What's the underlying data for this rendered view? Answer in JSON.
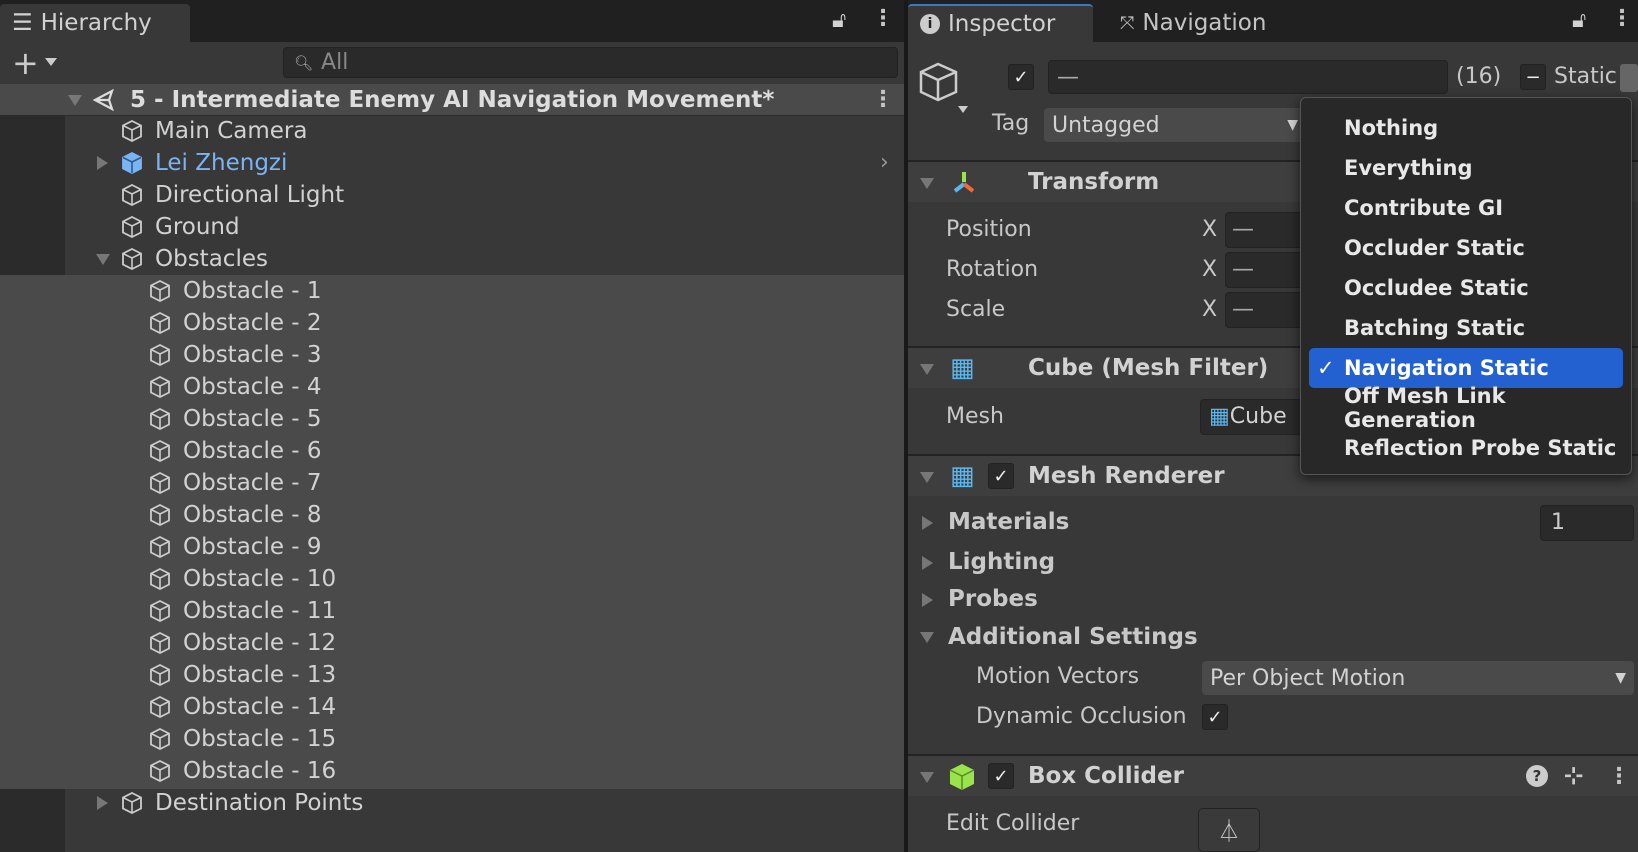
{
  "hierarchy": {
    "tab_label": "Hierarchy",
    "search_placeholder": "All",
    "scene": "5 - Intermediate Enemy AI Navigation Movement*",
    "items": [
      {
        "label": "Main Camera",
        "level": 1,
        "arrow": "none"
      },
      {
        "label": "Lei Zhengzi",
        "level": 1,
        "arrow": "collapsed",
        "prefab": true
      },
      {
        "label": "Directional Light",
        "level": 1,
        "arrow": "none"
      },
      {
        "label": "Ground",
        "level": 1,
        "arrow": "none"
      },
      {
        "label": "Obstacles",
        "level": 1,
        "arrow": "expanded"
      },
      {
        "label": "Obstacle - 1",
        "level": 2,
        "selected": true
      },
      {
        "label": "Obstacle - 2",
        "level": 2,
        "selected": true
      },
      {
        "label": "Obstacle - 3",
        "level": 2,
        "selected": true
      },
      {
        "label": "Obstacle - 4",
        "level": 2,
        "selected": true
      },
      {
        "label": "Obstacle - 5",
        "level": 2,
        "selected": true
      },
      {
        "label": "Obstacle - 6",
        "level": 2,
        "selected": true
      },
      {
        "label": "Obstacle - 7",
        "level": 2,
        "selected": true
      },
      {
        "label": "Obstacle - 8",
        "level": 2,
        "selected": true
      },
      {
        "label": "Obstacle - 9",
        "level": 2,
        "selected": true
      },
      {
        "label": "Obstacle - 10",
        "level": 2,
        "selected": true
      },
      {
        "label": "Obstacle - 11",
        "level": 2,
        "selected": true
      },
      {
        "label": "Obstacle - 12",
        "level": 2,
        "selected": true
      },
      {
        "label": "Obstacle - 13",
        "level": 2,
        "selected": true
      },
      {
        "label": "Obstacle - 14",
        "level": 2,
        "selected": true
      },
      {
        "label": "Obstacle - 15",
        "level": 2,
        "selected": true
      },
      {
        "label": "Obstacle - 16",
        "level": 2,
        "selected": true
      },
      {
        "label": "Destination Points",
        "level": 1,
        "arrow": "collapsed"
      }
    ]
  },
  "inspector": {
    "tabs": [
      "Inspector",
      "Navigation"
    ],
    "name_value": "—",
    "count": "(16)",
    "static_label": "Static",
    "tag_label": "Tag",
    "tag_value": "Untagged",
    "transform": {
      "title": "Transform",
      "rows": [
        {
          "label": "Position",
          "axis": "X",
          "value": "—"
        },
        {
          "label": "Rotation",
          "axis": "X",
          "value": "—"
        },
        {
          "label": "Scale",
          "axis": "X",
          "value": "—"
        }
      ]
    },
    "mesh_filter": {
      "title": "Cube (Mesh Filter)",
      "mesh_label": "Mesh",
      "mesh_value": "Cube"
    },
    "mesh_renderer": {
      "title": "Mesh Renderer",
      "materials": "Materials",
      "materials_count": "1",
      "lighting": "Lighting",
      "probes": "Probes",
      "additional": "Additional Settings",
      "motion_vectors_label": "Motion Vectors",
      "motion_vectors_value": "Per Object Motion",
      "dynamic_occlusion_label": "Dynamic Occlusion"
    },
    "box_collider": {
      "title": "Box Collider",
      "edit_collider_label": "Edit Collider"
    }
  },
  "static_menu": {
    "items": [
      "Nothing",
      "Everything",
      "Contribute GI",
      "Occluder Static",
      "Occludee Static",
      "Batching Static",
      "Navigation Static",
      "Off Mesh Link Generation",
      "Reflection Probe Static"
    ],
    "selected": "Navigation Static",
    "check": "✓"
  },
  "colors": {
    "selection": "#2360d0",
    "prefab": "#7ab4f5",
    "box_collider": "#9be34a"
  }
}
